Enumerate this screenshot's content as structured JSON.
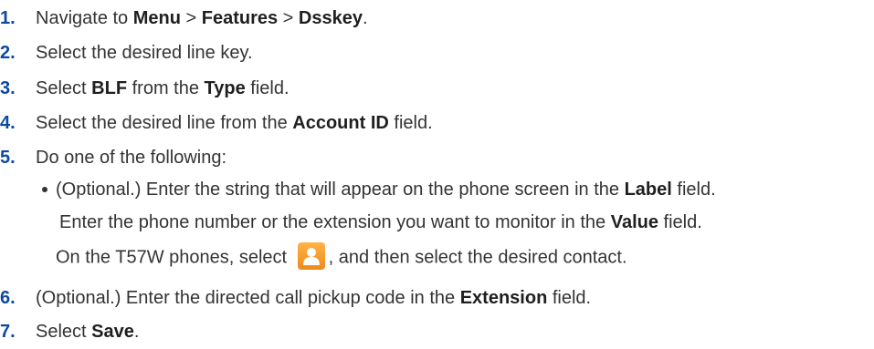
{
  "steps": [
    {
      "num": "1.",
      "parts": [
        "Navigate to ",
        "Menu",
        " > ",
        "Features",
        " > ",
        "Dsskey",
        "."
      ]
    },
    {
      "num": "2.",
      "text": "Select the desired line key."
    },
    {
      "num": "3.",
      "parts": [
        "Select ",
        "BLF",
        " from the ",
        "Type",
        " field."
      ]
    },
    {
      "num": "4.",
      "parts": [
        "Select the desired line from the ",
        "Account ID",
        " field."
      ]
    },
    {
      "num": "5.",
      "text": "Do one of the following:"
    },
    {
      "num": "6.",
      "parts": [
        "(Optional.) Enter the directed call pickup code in the ",
        "Extension",
        " field."
      ]
    },
    {
      "num": "7.",
      "parts": [
        "Select ",
        "Save",
        "."
      ]
    }
  ],
  "sub": {
    "line1": [
      "(Optional.) Enter the string that will appear on the phone screen in the ",
      "Label",
      " field."
    ],
    "line2": [
      "Enter the phone number or the extension you want to monitor in the ",
      "Value",
      " field."
    ],
    "line3": [
      "On the T57W phones, select ",
      ", and then select the desired contact."
    ]
  },
  "icons": {
    "contact": "contact-icon"
  },
  "colors": {
    "step_number": "#0b4aa0",
    "icon_orange": "#f08a1c"
  }
}
